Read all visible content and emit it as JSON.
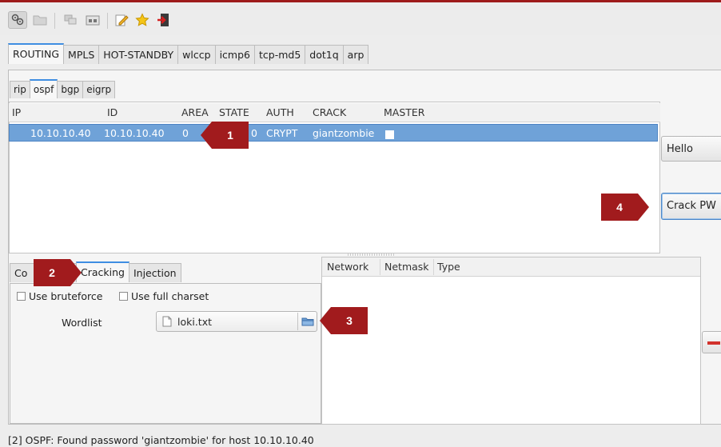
{
  "toolbar": {
    "icons": [
      "module-icon",
      "folder-icon",
      "network-icon",
      "ethernet-icon",
      "edit-icon",
      "star-icon",
      "exit-icon"
    ]
  },
  "protocol_tabs": [
    "ROUTING",
    "MPLS",
    "HOT-STANDBY",
    "wlccp",
    "icmp6",
    "tcp-md5",
    "dot1q",
    "arp"
  ],
  "routing_tabs": [
    "rip",
    "ospf",
    "bgp",
    "eigrp"
  ],
  "hosts_table": {
    "columns": [
      "IP",
      "ID",
      "AREA",
      "STATE",
      "AUTH",
      "CRACK",
      "MASTER"
    ],
    "rows": [
      {
        "ip": "10.10.10.40",
        "id": "10.10.10.40",
        "area": "0",
        "state": "0",
        "auth": "CRYPT",
        "crack": "giantzombie",
        "master": false
      }
    ]
  },
  "side_buttons": {
    "hello": "Hello",
    "crack_pw": "Crack PW"
  },
  "bottom_tabs": [
    "Co",
    "Cracking",
    "Injection"
  ],
  "cracking": {
    "use_bruteforce": "Use bruteforce",
    "use_full_charset": "Use full charset",
    "wordlist_label": "Wordlist",
    "wordlist_value": "loki.txt"
  },
  "network_table": {
    "columns": [
      "Network",
      "Netmask",
      "Type"
    ]
  },
  "status_text": "[2] OSPF: Found password 'giantzombie' for host 10.10.10.40",
  "markers": {
    "m1": "1",
    "m2": "2",
    "m3": "3",
    "m4": "4"
  },
  "colors": {
    "accent": "#a11b1d",
    "selection": "#6fa2d8",
    "tab_highlight": "#3f8ee2"
  }
}
